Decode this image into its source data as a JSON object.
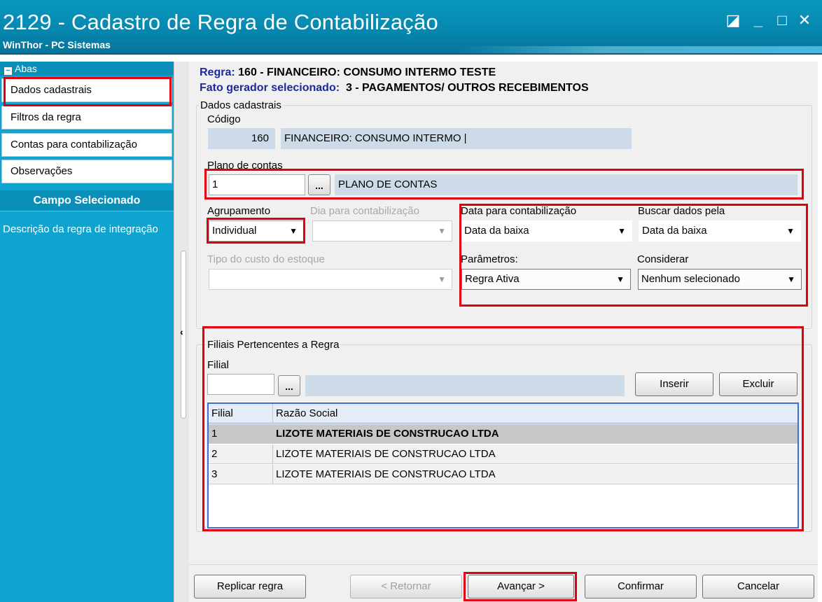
{
  "window": {
    "title": "2129 - Cadastro de Regra de Contabilização",
    "subtitle": "WinThor - PC Sistemas",
    "controls": {
      "restore": "◪",
      "minimize": "_",
      "maximize": "□",
      "close": "✕"
    }
  },
  "sidebar": {
    "header": "Abas",
    "tabs": [
      {
        "label": "Dados cadastrais"
      },
      {
        "label": "Filtros da regra"
      },
      {
        "label": "Contas para contabilização"
      },
      {
        "label": "Observações"
      }
    ],
    "campo_header": "Campo Selecionado",
    "campo_text": "Descrição da regra de integração"
  },
  "rule": {
    "regra_label": "Regra:",
    "regra_value": "160 - FINANCEIRO: CONSUMO INTERMO TESTE",
    "fato_label": "Fato gerador selecionado:",
    "fato_value": "3 - PAGAMENTOS/ OUTROS RECEBIMENTOS"
  },
  "dados": {
    "group_title": "Dados cadastrais",
    "codigo_label": "Código",
    "codigo_value": "160",
    "descricao_value": "FINANCEIRO: CONSUMO INTERMO |",
    "plano_label": "Plano de contas",
    "plano_code": "1",
    "plano_dots": "...",
    "plano_desc": "PLANO DE CONTAS",
    "agrupamento_label": "Agrupamento",
    "agrupamento_value": "Individual",
    "dia_label": "Dia para contabilização",
    "dia_value": "",
    "data_label": "Data para contabilização",
    "data_value": "Data da baixa",
    "buscar_label": "Buscar dados pela",
    "buscar_value": "Data da baixa",
    "tipo_custo_label": "Tipo do custo do estoque",
    "tipo_custo_value": "",
    "parametros_label": "Parâmetros:",
    "parametros_value": "Regra Ativa",
    "considerar_label": "Considerar",
    "considerar_value": "Nenhum selecionado"
  },
  "filiais": {
    "group_title": "Filiais Pertencentes a Regra",
    "filial_label": "Filial",
    "filial_value": "",
    "dots": "...",
    "desc_value": "",
    "inserir": "Inserir",
    "excluir": "Excluir",
    "columns": [
      "Filial",
      "Razão Social"
    ],
    "rows": [
      {
        "filial": "1",
        "razao": "LIZOTE MATERIAIS DE CONSTRUCAO LTDA",
        "selected": true
      },
      {
        "filial": "2",
        "razao": "LIZOTE MATERIAIS DE CONSTRUCAO LTDA",
        "selected": false
      },
      {
        "filial": "3",
        "razao": "LIZOTE MATERIAIS DE CONSTRUCAO LTDA",
        "selected": false
      }
    ]
  },
  "footer": {
    "replicar": "Replicar regra",
    "retornar": "< Retornar",
    "avancar": "Avançar >",
    "confirmar": "Confirmar",
    "cancelar": "Cancelar"
  },
  "icons": {
    "caret": "▼",
    "collapse": "‹",
    "minus": "−"
  },
  "colors": {
    "title_bar": "#0688b0",
    "sidebar": "#0ea4cf",
    "label_blue": "#1b2a9a",
    "highlight_red": "#e0000f",
    "grid_border": "#3d6fd6"
  }
}
